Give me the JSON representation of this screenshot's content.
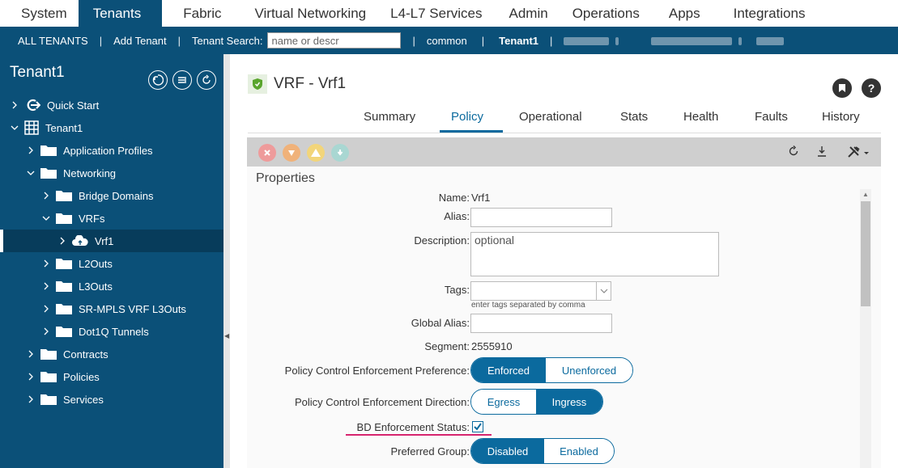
{
  "topnav": [
    "System",
    "Tenants",
    "Fabric",
    "Virtual Networking",
    "L4-L7 Services",
    "Admin",
    "Operations",
    "Apps",
    "Integrations"
  ],
  "subbar": {
    "all_tenants": "ALL TENANTS",
    "add_tenant": "Add Tenant",
    "search_label": "Tenant Search:",
    "search_placeholder": "name or descr",
    "common": "common",
    "current": "Tenant1"
  },
  "sidebar": {
    "title": "Tenant1",
    "tree": [
      {
        "label": "Quick Start"
      },
      {
        "label": "Tenant1"
      },
      {
        "label": "Application Profiles"
      },
      {
        "label": "Networking"
      },
      {
        "label": "Bridge Domains"
      },
      {
        "label": "VRFs"
      },
      {
        "label": "Vrf1"
      },
      {
        "label": "L2Outs"
      },
      {
        "label": "L3Outs"
      },
      {
        "label": "SR-MPLS VRF L3Outs"
      },
      {
        "label": "Dot1Q Tunnels"
      },
      {
        "label": "Contracts"
      },
      {
        "label": "Policies"
      },
      {
        "label": "Services"
      }
    ]
  },
  "main": {
    "title": "VRF - Vrf1",
    "tabs": [
      "Summary",
      "Policy",
      "Operational",
      "Stats",
      "Health",
      "Faults",
      "History"
    ],
    "properties_title": "Properties",
    "fields": {
      "name_label": "Name:",
      "name_value": "Vrf1",
      "alias_label": "Alias:",
      "description_label": "Description:",
      "description_placeholder": "optional",
      "tags_label": "Tags:",
      "tags_hint": "enter tags separated by comma",
      "global_alias_label": "Global Alias:",
      "segment_label": "Segment:",
      "segment_value": "2555910",
      "pce_pref_label": "Policy Control Enforcement Preference:",
      "pce_pref_options": [
        "Enforced",
        "Unenforced"
      ],
      "pce_dir_label": "Policy Control Enforcement Direction:",
      "pce_dir_options": [
        "Egress",
        "Ingress"
      ],
      "bd_enf_label": "BD Enforcement Status:",
      "pref_group_label": "Preferred Group:",
      "pref_group_options": [
        "Disabled",
        "Enabled"
      ]
    }
  },
  "colors": {
    "brand": "#0b5078",
    "accent": "#0b6a9e",
    "highlight": "#d6246e"
  }
}
